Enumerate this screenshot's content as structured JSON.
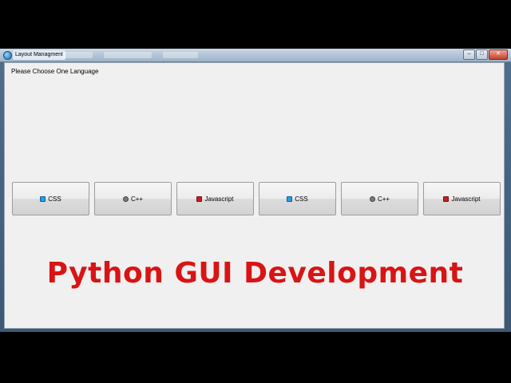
{
  "window": {
    "title": "Layout Managment",
    "min_glyph": "–",
    "max_glyph": "□",
    "close_glyph": "✕"
  },
  "client": {
    "prompt": "Please Choose One Language"
  },
  "buttons": [
    {
      "label": "CSS",
      "icon": "css-icon"
    },
    {
      "label": "C++",
      "icon": "cpp-icon"
    },
    {
      "label": "Javascript",
      "icon": "js-icon"
    },
    {
      "label": "CSS",
      "icon": "css-icon"
    },
    {
      "label": "C++",
      "icon": "cpp-icon"
    },
    {
      "label": "Javascript",
      "icon": "js-icon"
    }
  ],
  "overlay": {
    "headline": "Python GUI Development"
  },
  "colors": {
    "headline": "#d81414",
    "window_bg": "#f0f0f0",
    "titlebar": "#9eb3c9"
  }
}
